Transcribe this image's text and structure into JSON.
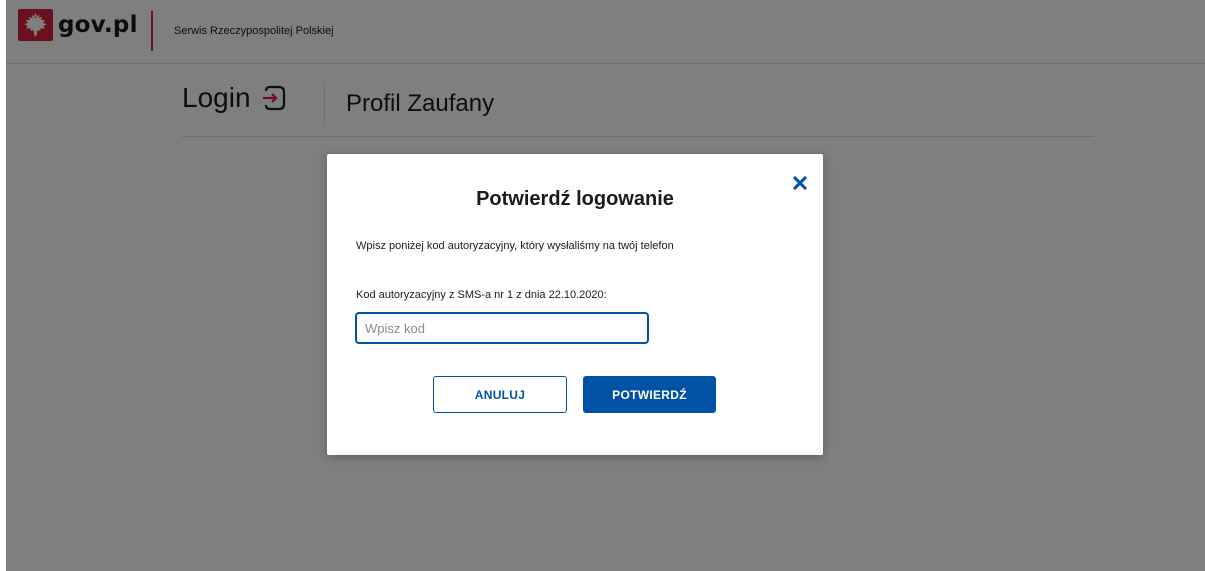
{
  "header": {
    "logo_text": "gov.pl",
    "service_name": "Serwis Rzeczypospolitej Polskiej"
  },
  "login_header": {
    "title": "Login",
    "service": "Profil Zaufany"
  },
  "modal": {
    "title": "Potwierdź logowanie",
    "description": "Wpisz poniżej kod autoryzacyjny, który wysłaliśmy na twój telefon",
    "field_label": "Kod autoryzacyjny z SMS-a nr 1 z dnia 22.10.2020:",
    "input_placeholder": "Wpisz kod",
    "input_value": "",
    "cancel_label": "ANULUJ",
    "confirm_label": "POTWIERDŹ"
  },
  "colors": {
    "accent": "#0052a5",
    "brand_red": "#d4213d",
    "overlay": "rgba(0,0,0,0.5)"
  },
  "icons": [
    "gov-emblem-icon",
    "login-icon",
    "close-icon"
  ]
}
